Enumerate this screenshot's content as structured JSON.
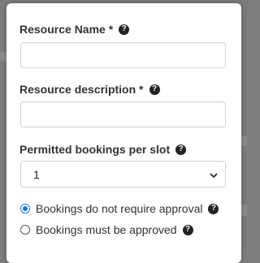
{
  "form": {
    "resource_name": {
      "label": "Resource Name *",
      "value": ""
    },
    "resource_description": {
      "label": "Resource description *",
      "value": ""
    },
    "permitted_bookings": {
      "label": "Permitted bookings per slot",
      "selected": "1"
    },
    "approval": {
      "options": [
        {
          "label": "Bookings do not require approval",
          "checked": true
        },
        {
          "label": "Bookings must be approved",
          "checked": false
        }
      ]
    }
  },
  "icons": {
    "help": "question-circle-icon",
    "select_arrow": "chevron-down-icon"
  },
  "colors": {
    "accent": "#1a73e8",
    "backdrop": "#7b7b7b"
  }
}
